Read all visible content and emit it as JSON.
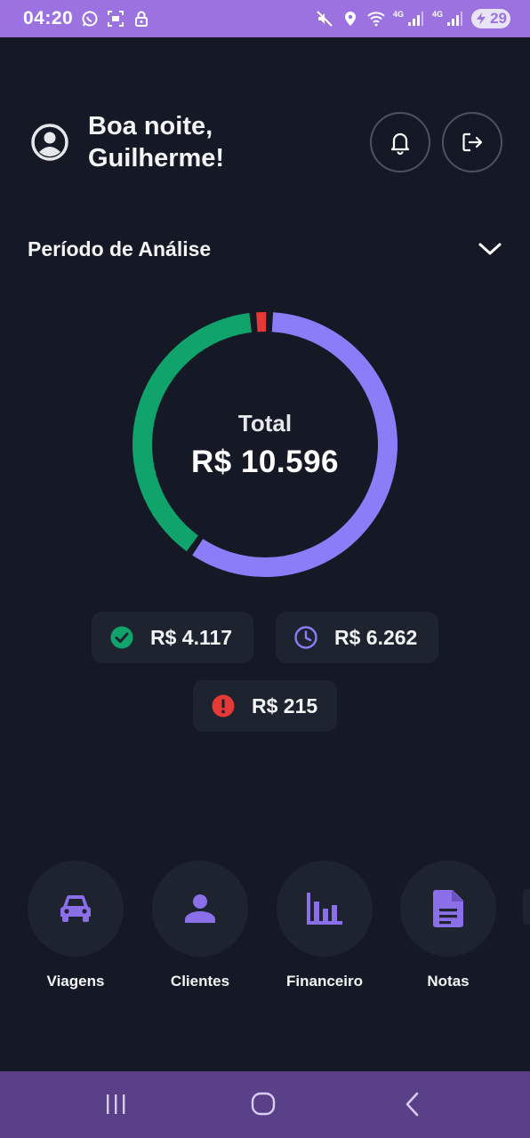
{
  "status_bar": {
    "time": "04:20",
    "network_label_1": "4G",
    "network_label_2": "4G",
    "battery": "29",
    "icons": [
      "whatsapp-icon",
      "screenshot-icon",
      "lock-icon",
      "mute-icon",
      "location-icon",
      "wifi-icon",
      "signal-icon",
      "signal-icon",
      "battery-icon"
    ]
  },
  "header": {
    "greeting_line1": "Boa noite,",
    "greeting_line2": "Guilherme!",
    "icons": [
      "user-avatar-icon",
      "bell-icon",
      "logout-icon"
    ]
  },
  "period": {
    "label": "Período de Análise",
    "icon": "chevron-down-icon"
  },
  "summary": {
    "total_label": "Total",
    "total_value": "R$ 10.596",
    "colors": {
      "paid": "#10a36b",
      "pending": "#8b7cf8",
      "overdue": "#e53935"
    },
    "chips": [
      {
        "status": "paid",
        "icon": "check-circle-icon",
        "value": "R$ 4.117",
        "amount": 4117
      },
      {
        "status": "pending",
        "icon": "clock-icon",
        "value": "R$ 6.262",
        "amount": 6262
      },
      {
        "status": "overdue",
        "icon": "alert-circle-icon",
        "value": "R$ 215",
        "amount": 215
      }
    ]
  },
  "actions": [
    {
      "label": "Viagens",
      "icon": "car-icon"
    },
    {
      "label": "Clientes",
      "icon": "person-icon"
    },
    {
      "label": "Financeiro",
      "icon": "bar-chart-icon"
    },
    {
      "label": "Notas",
      "icon": "document-icon"
    }
  ],
  "system_nav": {
    "icons": [
      "recent-apps-icon",
      "home-icon",
      "back-icon"
    ]
  },
  "accent_color": "#9b72e0"
}
